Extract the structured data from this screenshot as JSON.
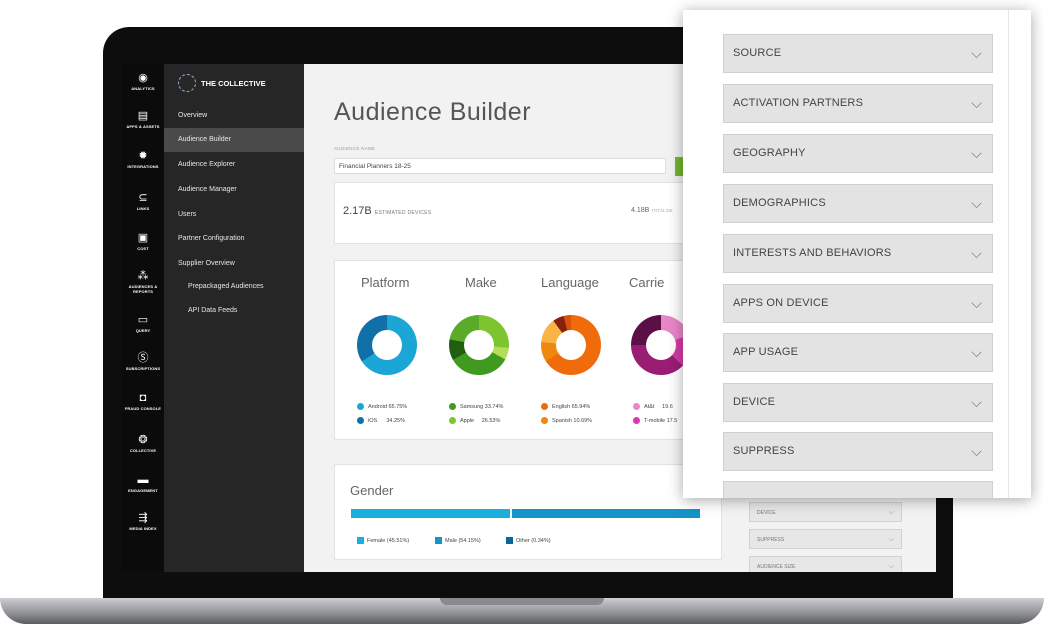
{
  "rail": {
    "items": [
      {
        "icon": "◉",
        "label": "ANALYTICS"
      },
      {
        "icon": "▤",
        "label": "APPS & ASSETS"
      },
      {
        "icon": "✹",
        "label": "INTEGRATIONS"
      },
      {
        "icon": "⊆",
        "label": "LINKS"
      },
      {
        "icon": "▣",
        "label": "COST"
      },
      {
        "icon": "⁂",
        "label": "AUDIENCES & REPORTS"
      },
      {
        "icon": "▭",
        "label": "QUERY"
      },
      {
        "icon": "Ⓢ",
        "label": "SUBSCRIPTIONS"
      },
      {
        "icon": "◘",
        "label": "FRAUD CONSOLE"
      },
      {
        "icon": "❂",
        "label": "COLLECTIVE"
      },
      {
        "icon": "▬",
        "label": "ENGAGEMENT"
      },
      {
        "icon": "⇶",
        "label": "MEDIA INDEX"
      }
    ]
  },
  "nav": {
    "brand": "THE COLLECTIVE",
    "items": [
      "Overview",
      "Audience Builder",
      "Audience Explorer",
      "Audience Manager",
      "Users",
      "Partner Configuration",
      "Supplier Overview"
    ],
    "sub_items": [
      "Prepackaged Audiences",
      "API Data Feeds"
    ]
  },
  "main": {
    "title": "Audience Builder",
    "audience_name_label": "AUDIENCE NAME",
    "audience_name_value": "Financial Planners 18-25",
    "estimated_value": "2.17B",
    "estimated_label": "ESTIMATED DEVICES",
    "total_value": "4.18B",
    "total_label": "TOTAL DE"
  },
  "donuts": [
    {
      "title": "Platform",
      "legend": [
        {
          "label": "Android",
          "pct": "65.75%",
          "color": "#1ba6d6"
        },
        {
          "label": "iOS",
          "pct": "34.25%",
          "color": "#1170a8"
        }
      ]
    },
    {
      "title": "Make",
      "legend": [
        {
          "label": "Samsung",
          "pct": "33.74%",
          "color": "#3f9a1f"
        },
        {
          "label": "Apple",
          "pct": "26.53%",
          "color": "#7cc52e"
        }
      ]
    },
    {
      "title": "Language",
      "legend": [
        {
          "label": "English",
          "pct": "65.94%",
          "color": "#f06b0c"
        },
        {
          "label": "Spanish",
          "pct": "10.69%",
          "color": "#f0880f"
        }
      ]
    },
    {
      "title": "Carrie",
      "legend": [
        {
          "label": "At&t",
          "pct": "19.6",
          "color": "#e986c8"
        },
        {
          "label": "T-mobile",
          "pct": "17.5",
          "color": "#d83aa6"
        }
      ]
    }
  ],
  "gender": {
    "title": "Gender",
    "legend": [
      {
        "label": "Female (45.51%)",
        "color": "#1ab0dd"
      },
      {
        "label": "Male (54.15%)",
        "color": "#1594c7"
      },
      {
        "label": "Other (0.34%)",
        "color": "#0b6597"
      }
    ],
    "shares": [
      45.51,
      54.15,
      0.34
    ]
  },
  "mini_filters": [
    "DEVICE",
    "SUPPRESS",
    "AUDIENCE SIZE"
  ],
  "filters": [
    "SOURCE",
    "ACTIVATION PARTNERS",
    "GEOGRAPHY",
    "DEMOGRAPHICS",
    "INTERESTS AND BEHAVIORS",
    "APPS ON DEVICE",
    "APP USAGE",
    "DEVICE",
    "SUPPRESS"
  ],
  "colors": {
    "accent_green": "#72b62e",
    "nav_bg": "#262626",
    "rail_bg": "#0b0b0b"
  }
}
